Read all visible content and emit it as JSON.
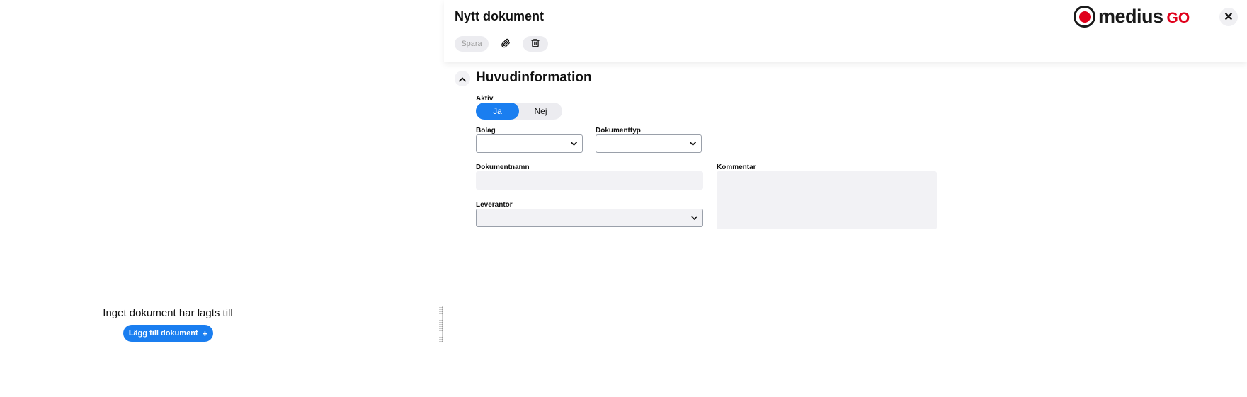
{
  "left": {
    "empty_message": "Inget dokument har lagts till",
    "add_button": "Lägg till dokument",
    "add_button_plus": "+"
  },
  "header": {
    "title": "Nytt dokument",
    "save_label": "Spara",
    "logo_word": "medius",
    "logo_go": "GO",
    "close_symbol": "✕"
  },
  "section": {
    "title": "Huvudinformation",
    "aktiv_label": "Aktiv",
    "aktiv_options": [
      "Ja",
      "Nej"
    ],
    "aktiv_selected": "Ja",
    "bolag_label": "Bolag",
    "bolag_value": "",
    "dokumenttyp_label": "Dokumenttyp",
    "dokumenttyp_value": "",
    "dokumentnamn_label": "Dokumentnamn",
    "dokumentnamn_value": "",
    "leverantor_label": "Leverantör",
    "leverantor_value": "",
    "kommentar_label": "Kommentar",
    "kommentar_value": ""
  },
  "icons": {
    "attach": "paperclip-icon",
    "trash": "trash-icon",
    "collapse": "chevron-up-icon",
    "dropdown": "chevron-down-icon",
    "close": "close-icon"
  },
  "colors": {
    "accent": "#1a7ef0",
    "brand_red": "#e0001b"
  }
}
